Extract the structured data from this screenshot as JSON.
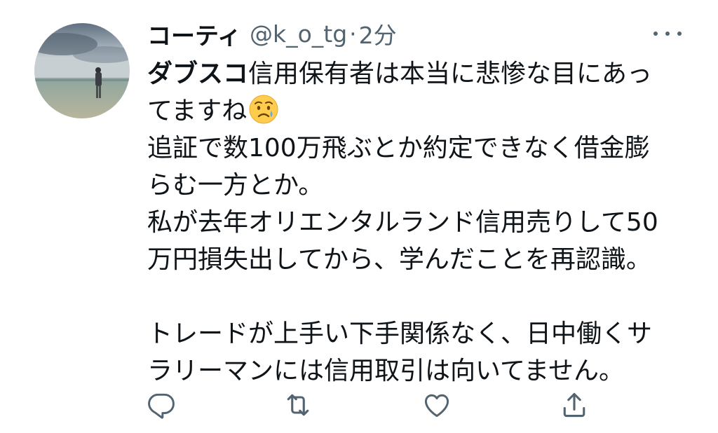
{
  "tweet": {
    "author": {
      "display_name": "コーティ",
      "handle": "@k_o_tg",
      "separator": "·",
      "timestamp": "2分"
    },
    "lines": [
      {
        "bold": "ダブスコ",
        "text": "信用保有者は本当に悲惨な目にあっ"
      },
      {
        "text": "てますね",
        "emoji": "sad-but-relieved-face"
      },
      {
        "text": "追証で数100万飛ぶとか約定できなく借金膨"
      },
      {
        "text": "らむ一方とか。"
      },
      {
        "text": "私が去年オリエンタルランド信用売りして50"
      },
      {
        "text": "万円損失出してから、学んだことを再認識。"
      },
      {
        "text": ""
      },
      {
        "text": "トレードが上手い下手関係なく、日中働くサ"
      },
      {
        "text": "ラリーマンには信用取引は向いてません。"
      }
    ]
  },
  "actions": {
    "reply": "reply-icon",
    "retweet": "retweet-icon",
    "like": "like-icon",
    "share": "share-icon"
  },
  "colors": {
    "text": "#0f1419",
    "secondary": "#536471",
    "emoji": "#ffcc4d"
  }
}
